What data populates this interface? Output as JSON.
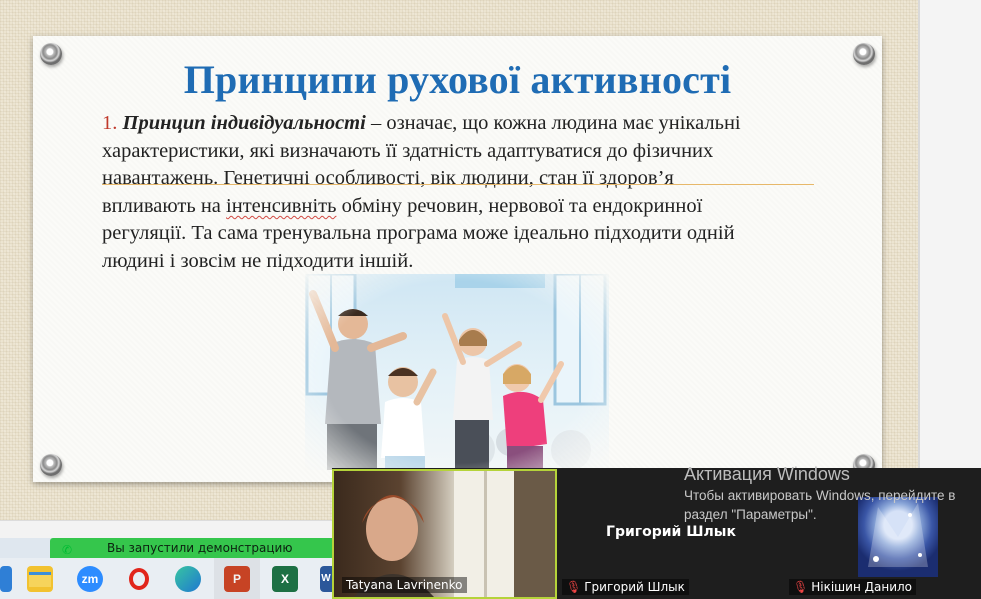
{
  "slide": {
    "title": "Принципи рухової активності",
    "number": "1.",
    "lead": "Принцип індивідуальності",
    "line1_rest": " – означає, що кожна людина має унікальні",
    "line2": "характеристики, які визначають її здатність адаптуватися до фізичних",
    "line3": "навантажень. Генетичні особливості, вік людини, стан її здоров’я",
    "line4a": "впливають на ",
    "line4b": "інтенсивніть",
    "line4c": " обміну речовин, нервової та ендокринної",
    "line5": "регуляції. Та сама тренувальна програма може ідеально підходити одній",
    "line6": "людині і зовсім не підходити іншій."
  },
  "notice": {
    "text": "Вы запустили демонстрацию экрана"
  },
  "taskbar": {
    "zoom_label": "zm",
    "word_label": "W",
    "excel_label": "X",
    "ppt_label": "P"
  },
  "meeting": {
    "participant1": "Tatyana Lavrinenko",
    "participant2_center": "Григорий Шлык",
    "participant2_tag": "Григорий Шлык",
    "participant3_tag": "Нікішин Данило"
  },
  "activation": {
    "title": "Активация Windows",
    "line1": "Чтобы активировать Windows, перейдите в",
    "line2": "раздел \"Параметры\"."
  },
  "colors": {
    "title_blue": "#1f6cb4",
    "number_red": "#c0392b",
    "notice_green": "#35c64c",
    "tile_border": "#b5d33a"
  }
}
